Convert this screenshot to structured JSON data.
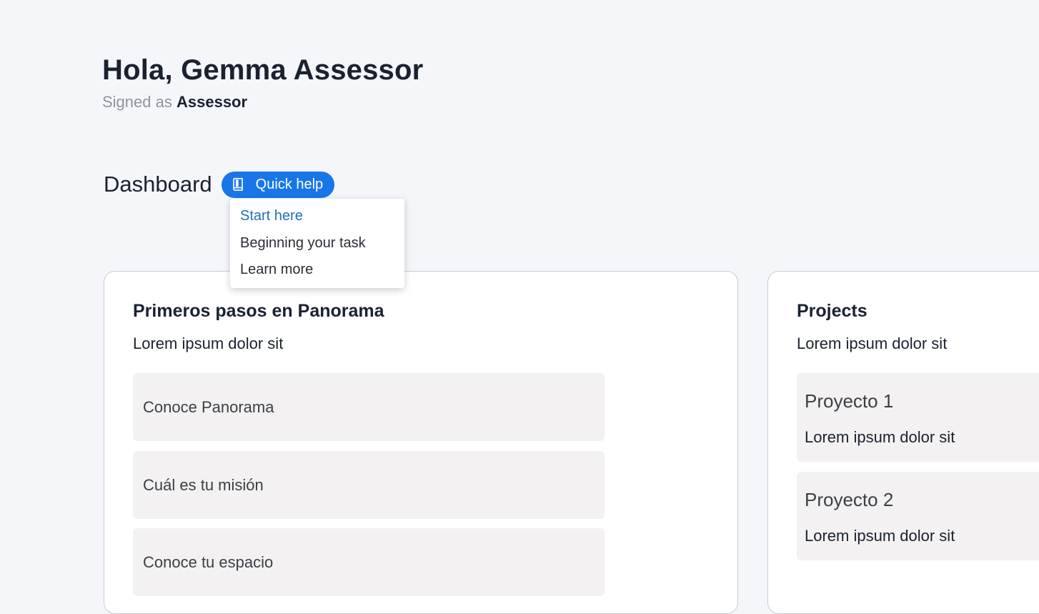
{
  "header": {
    "greeting": "Hola, Gemma Assessor",
    "signed_prefix": "Signed as",
    "role": "Assessor"
  },
  "dashboard": {
    "title": "Dashboard",
    "quick_help": {
      "label": "Quick help",
      "icon": "book-icon",
      "color": "#1976e8",
      "menu": [
        {
          "label": "Start here",
          "active": true
        },
        {
          "label": "Beginning your task",
          "active": false
        },
        {
          "label": "Learn more",
          "active": false
        }
      ]
    }
  },
  "getting_started": {
    "title": "Primeros pasos en Panorama",
    "subtitle": "Lorem ipsum dolor sit",
    "steps": [
      {
        "label": "Conoce Panorama"
      },
      {
        "label": "Cuál es tu misión"
      },
      {
        "label": "Conoce tu espacio"
      }
    ]
  },
  "projects": {
    "title": "Projects",
    "subtitle": "Lorem ipsum dolor sit",
    "items": [
      {
        "name": "Proyecto 1",
        "description": "Lorem ipsum dolor sit"
      },
      {
        "name": "Proyecto 2",
        "description": "Lorem ipsum dolor sit"
      }
    ]
  }
}
